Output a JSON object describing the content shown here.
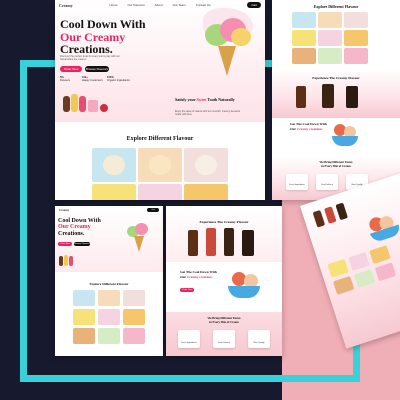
{
  "brand": {
    "logo": "Creamy",
    "cart_label": "Cart"
  },
  "nav": {
    "links": [
      "Home",
      "Our Flavours",
      "About",
      "Our Team",
      "Contact Us"
    ]
  },
  "hero": {
    "line1": "Cool Down With",
    "line2": "Our Creamy",
    "line3": "Creations.",
    "desc": "Discover the perfect treat for every sunny day with our handcrafted ice creams.",
    "cta_primary": "Order Now",
    "cta_secondary": "Browse Flavours",
    "stats": [
      {
        "value": "50+",
        "label": "Flavours"
      },
      {
        "value": "10k+",
        "label": "Happy Customers"
      },
      {
        "value": "100%",
        "label": "Organic Ingredients"
      }
    ]
  },
  "promo": {
    "title_start": "Satisfy your",
    "title_accent": "Sweet",
    "title_end": "Tooth Naturally",
    "desc": "Enjoy the taste of nature with our smooth, creamy desserts made with love."
  },
  "flavours": {
    "title": "Explore Different Flavour"
  },
  "popular": {
    "title": "Experience The Creamy Flavour"
  },
  "cool_down": {
    "line1": "Get The Cool Down With",
    "line2_start": "Our",
    "line2_accent": "Creamy creations",
    "desc": "Treat yourself to the sweet and refreshing flavours we create every day.",
    "cta": "Order Now"
  },
  "features": {
    "title": "We Bring Different Tastes",
    "subtitle": "in Every Bite of Cream",
    "items": [
      "Fresh Ingredients",
      "Fast Delivery",
      "Best Quality"
    ]
  },
  "colors": {
    "accent": "#e8255f",
    "frame": "#38d1d9",
    "navy": "#17192e",
    "pink_bg": "#f0aeb6"
  }
}
